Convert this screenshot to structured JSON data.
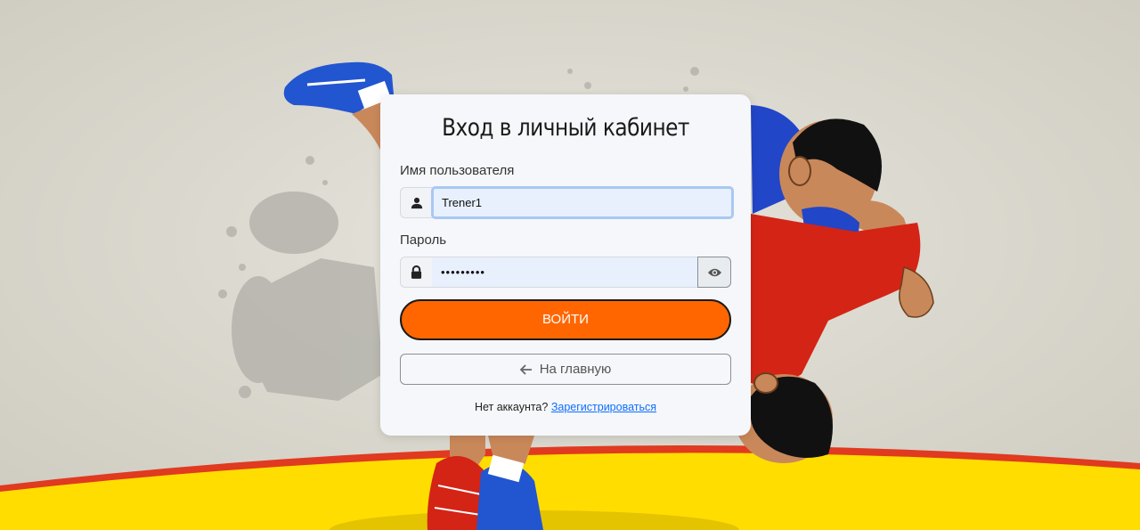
{
  "login": {
    "title": "Вход в личный кабинет",
    "username_label": "Имя пользователя",
    "username_value": "Trener1",
    "password_label": "Пароль",
    "password_value": "•••••••••",
    "submit_label": "ВОЙТИ",
    "home_label": "На главную",
    "no_account_text": "Нет аккаунта?",
    "register_link": "Зарегистрироваться"
  },
  "icons": {
    "username": "user-icon",
    "password": "lock-icon",
    "toggle_password": "eye-icon",
    "back": "arrow-left-icon"
  },
  "colors": {
    "accent": "#ff6600",
    "link": "#0d6efd",
    "mat": "#ffdd00",
    "mat_border": "#e33b1f"
  }
}
